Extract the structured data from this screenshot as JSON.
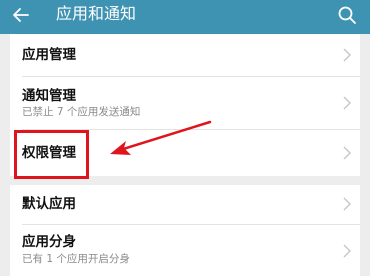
{
  "header": {
    "title": "应用和通知",
    "back_icon": "back-arrow-icon",
    "search_icon": "search-icon",
    "bg_color": "#3f93b2"
  },
  "items": [
    {
      "label": "应用管理",
      "sub": ""
    },
    {
      "label": "通知管理",
      "sub": "已禁止 7 个应用发送通知"
    },
    {
      "label": "权限管理",
      "sub": ""
    },
    {
      "label": "默认应用",
      "sub": ""
    },
    {
      "label": "应用分身",
      "sub": "已有 1 个应用开启分身"
    }
  ],
  "annotation": {
    "highlight_color": "#e0141c",
    "highlight_target": "权限管理"
  }
}
